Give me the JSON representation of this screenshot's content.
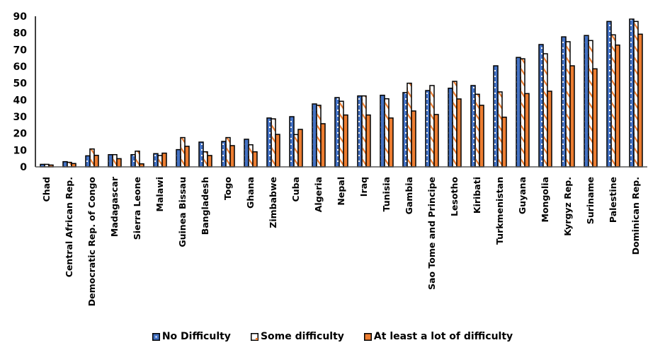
{
  "chart_data": {
    "type": "bar",
    "title": "",
    "xlabel": "",
    "ylabel": "",
    "ylim": [
      0,
      90
    ],
    "yticks": [
      0,
      10,
      20,
      30,
      40,
      50,
      60,
      70,
      80,
      90
    ],
    "grid": false,
    "legend_position": "bottom",
    "categories": [
      "Chad",
      "Central African Rep.",
      "Democratic Rep. of Congo",
      "Madagascar",
      "Sierra Leone",
      "Malawi",
      "Guinea Bissau",
      "Bangladesh",
      "Togo",
      "Ghana",
      "Zimbabwe",
      "Cuba",
      "Algeria",
      "Nepal",
      "Iraq",
      "Tunisia",
      "Gambia",
      "Sao Tome and Principe",
      "Lesotho",
      "Kiribati",
      "Turkmenistan",
      "Guyana",
      "Mongolia",
      "Kyrgyz Rep.",
      "Suriname",
      "Palestine",
      "Dominican Rep."
    ],
    "series": [
      {
        "name": "No Difficulty",
        "color": "#4472C4",
        "pattern": "dotted",
        "values": [
          1.5,
          3.1,
          6.6,
          7.3,
          7.3,
          7.9,
          10.3,
          14.8,
          15.2,
          16.5,
          29.2,
          30.0,
          37.6,
          41.4,
          42.4,
          42.8,
          44.4,
          45.6,
          47.0,
          48.6,
          60.4,
          65.4,
          73.1,
          77.7,
          78.5,
          86.9,
          88.3
        ]
      },
      {
        "name": "Some difficulty",
        "color": "#ED7D31",
        "pattern": "diagonal-stripes-on-white",
        "values": [
          1.5,
          2.7,
          10.7,
          7.3,
          9.4,
          6.8,
          17.5,
          9.0,
          17.5,
          13.2,
          28.7,
          19.3,
          36.8,
          39.2,
          42.4,
          40.7,
          50.0,
          48.6,
          51.1,
          43.4,
          44.8,
          64.6,
          67.6,
          74.8,
          75.5,
          78.9,
          86.9
        ]
      },
      {
        "name": "At least a lot of difficulty",
        "color": "#ED7D31",
        "pattern": "solid",
        "values": [
          1.1,
          2.0,
          6.9,
          4.9,
          1.8,
          8.2,
          12.3,
          6.8,
          12.7,
          9.0,
          19.4,
          22.4,
          25.8,
          31.0,
          31.0,
          29.2,
          33.4,
          31.3,
          40.6,
          36.8,
          29.7,
          43.8,
          45.2,
          60.4,
          58.6,
          72.8,
          79.3
        ]
      }
    ]
  }
}
